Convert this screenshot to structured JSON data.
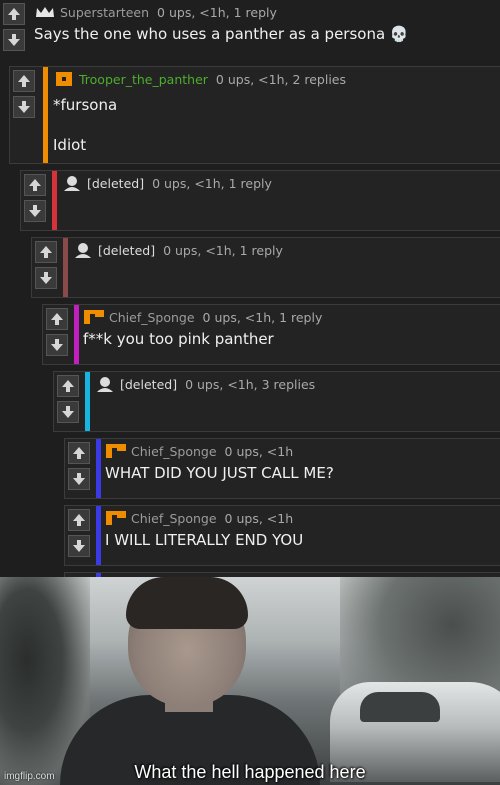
{
  "comments": [
    {
      "username": "Superstarteen",
      "meta": "0 ups, <1h, 1 reply",
      "avatar": "crown-icon",
      "lines": [
        "Says the one who uses a panther as a persona 💀"
      ],
      "bar_color": null
    },
    {
      "username": "Trooper_the_panther",
      "meta": "0 ups, <1h, 2 replies",
      "avatar": "orange-square-icon",
      "lines": [
        "*fursona",
        "Idiot"
      ],
      "bar_color": "#f08c00"
    },
    {
      "username": "[deleted]",
      "meta": "0 ups, <1h, 1 reply",
      "avatar": "default-user-icon",
      "lines": [],
      "bar_color": "#d6323b"
    },
    {
      "username": "[deleted]",
      "meta": "0 ups, <1h, 1 reply",
      "avatar": "default-user-icon",
      "lines": [],
      "bar_color": "#8b4a4a"
    },
    {
      "username": "Chief_Sponge",
      "meta": "0 ups, <1h, 1 reply",
      "avatar": "orange-flag-icon",
      "lines": [
        "f**k you too pink panther"
      ],
      "bar_color": "#c21fbf"
    },
    {
      "username": "[deleted]",
      "meta": "0 ups, <1h, 3 replies",
      "avatar": "default-user-icon",
      "lines": [],
      "bar_color": "#18b4e0"
    },
    {
      "username": "Chief_Sponge",
      "meta": "0 ups, <1h",
      "avatar": "orange-flag-icon",
      "lines": [
        "WHAT DID YOU JUST CALL ME?"
      ],
      "bar_color": "#3a3ae6"
    },
    {
      "username": "Chief_Sponge",
      "meta": "0 ups, <1h",
      "avatar": "orange-flag-icon",
      "lines": [
        "I WILL LITERALLY END YOU"
      ],
      "bar_color": "#3a3ae6"
    }
  ],
  "meme": {
    "caption": "What the hell happened here",
    "watermark": "imgflip.com"
  },
  "colors": {
    "orange": "#f08c00",
    "green_username": "#4cae2c",
    "background": "#1e1e1e"
  }
}
